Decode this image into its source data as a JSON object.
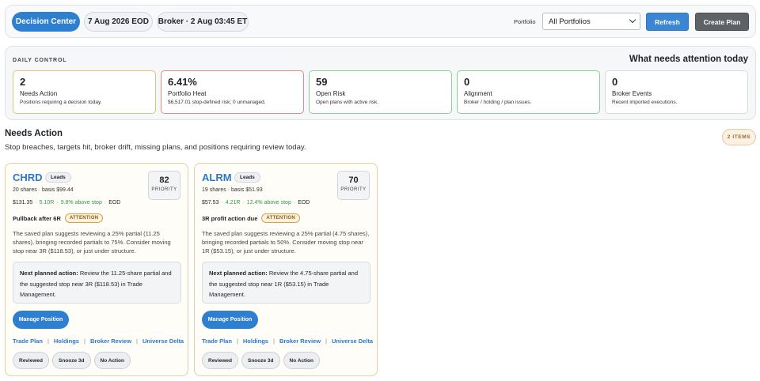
{
  "topbar": {
    "decision_center": "Decision Center",
    "eod_date": "7 Aug 2026 EOD",
    "broker_status": "Broker · 2 Aug 03:45 ET",
    "portfolio_label": "Portfolio",
    "portfolio_selected": "All Portfolios",
    "refresh_label": "Refresh",
    "create_plan_label": "Create Plan"
  },
  "daily": {
    "label": "DAILY CONTROL",
    "heading": "What needs attention today",
    "metrics": [
      {
        "value": "2",
        "name": "Needs Action",
        "desc": "Positions requiring a decision today."
      },
      {
        "value": "6.41%",
        "name": "Portfolio Heat",
        "desc": "$6,517.01 stop-defined risk; 0 unmanaged."
      },
      {
        "value": "59",
        "name": "Open Risk",
        "desc": "Open plans with active risk."
      },
      {
        "value": "0",
        "name": "Alignment",
        "desc": "Broker / holding / plan issues."
      },
      {
        "value": "0",
        "name": "Broker Events",
        "desc": "Recent imported executions."
      }
    ]
  },
  "needs_action": {
    "title": "Needs Action",
    "subtitle": "Stop breaches, targets hit, broker drift, missing plans, and positions requiring review today.",
    "count": "2 ITEMS"
  },
  "cards": [
    {
      "ticker": "CHRD",
      "group": "Leads",
      "shares": "20 shares · basis $99.44",
      "priority": "82",
      "priority_label": "PRIORITY",
      "price": "$131.35",
      "r_multiple": "5.10R",
      "above_stop": "9.8% above stop",
      "source": "EOD",
      "status": "Pullback after 6R",
      "badge": "ATTENTION",
      "note": "The saved plan suggests reviewing a 25% partial (11.25 shares), bringing recorded partials to 75%. Consider moving stop near 3R ($118.53), or just under structure.",
      "next_label": "Next planned action:",
      "next_text": "Review the 11.25-share partial and the suggested stop near 3R ($118.53) in Trade Management.",
      "manage": "Manage Position",
      "links": [
        "Trade Plan",
        "Holdings",
        "Broker Review",
        "Universe Delta"
      ],
      "actions": [
        "Reviewed",
        "Snooze 3d",
        "No Action"
      ]
    },
    {
      "ticker": "ALRM",
      "group": "Leads",
      "shares": "19 shares · basis $51.93",
      "priority": "70",
      "priority_label": "PRIORITY",
      "price": "$57.53",
      "r_multiple": "4.21R",
      "above_stop": "12.4% above stop",
      "source": "EOD",
      "status": "3R profit action due",
      "badge": "ATTENTION",
      "note": "The saved plan suggests reviewing a 25% partial (4.75 shares), bringing recorded partials to 50%. Consider moving stop near 1R ($53.15), or just under structure.",
      "next_label": "Next planned action:",
      "next_text": "Review the 4.75-share partial and the suggested stop near 1R ($53.15) in Trade Management.",
      "manage": "Manage Position",
      "links": [
        "Trade Plan",
        "Holdings",
        "Broker Review",
        "Universe Delta"
      ],
      "actions": [
        "Reviewed",
        "Snooze 3d",
        "No Action"
      ]
    }
  ]
}
